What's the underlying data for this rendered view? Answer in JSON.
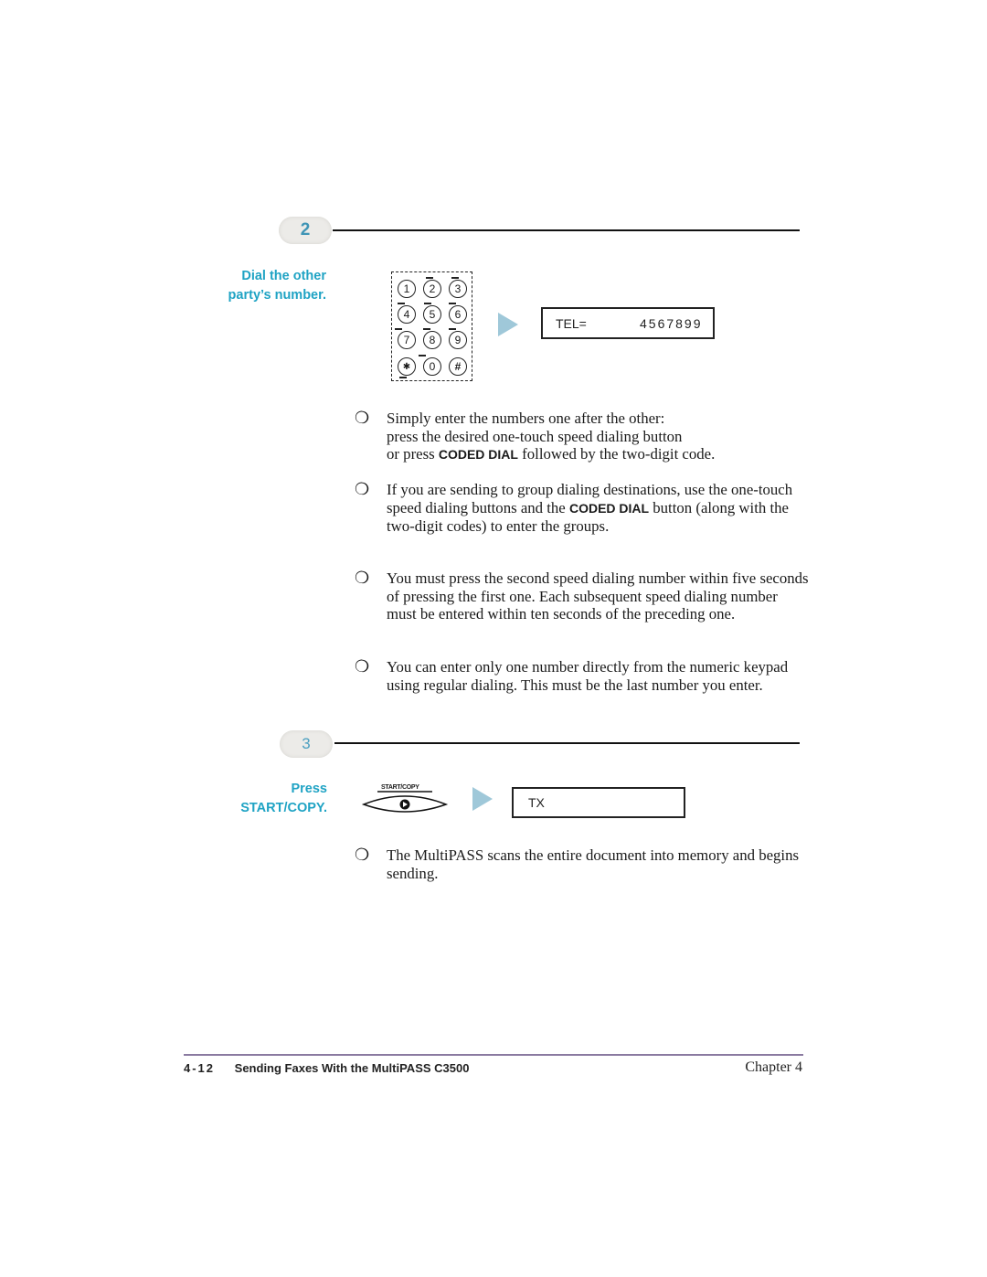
{
  "step2": {
    "number": "2",
    "side_label_line1": "Dial the other",
    "side_label_line2": "party’s number.",
    "keypad_keys": [
      "1",
      "2",
      "3",
      "4",
      "5",
      "6",
      "7",
      "8",
      "9",
      "✱",
      "0",
      "#"
    ],
    "lcd_label": "TEL=",
    "lcd_value": "4567899",
    "bullets": [
      {
        "parts": [
          "Simply enter the numbers one after the other:",
          "press the desired one-touch speed dialing button",
          "or press ",
          "CODED DIAL",
          " followed by the two-digit code."
        ]
      },
      {
        "parts": [
          "If you are sending to group dialing destinations, use the one-touch speed dialing buttons and the ",
          "CODED DIAL",
          " button (along with the two-digit codes) to enter the groups."
        ]
      },
      {
        "text": "You must press the second speed dialing number within five seconds of pressing the first one. Each subsequent speed dialing number must be entered within ten seconds of the preceding one."
      },
      {
        "text": "You can enter only one number directly from the numeric keypad using regular dialing. This must be the last number you enter."
      }
    ]
  },
  "step3": {
    "number": "3",
    "side_label_line1": "Press",
    "side_label_line2": "START/COPY.",
    "button_caption": "START/COPY",
    "lcd_label": "TX",
    "bullets": [
      {
        "text": "The MultiPASS scans the entire document into memory and begins sending."
      }
    ]
  },
  "bullet_glyph": "❍",
  "footer": {
    "page_number": "4-12",
    "title": "Sending Faxes With the MultiPASS C3500",
    "chapter": "Chapter 4"
  },
  "colors": {
    "accent": "#1fa3c4",
    "step_number": "#3f95b6",
    "footer_rule": "#8a7aa0"
  }
}
